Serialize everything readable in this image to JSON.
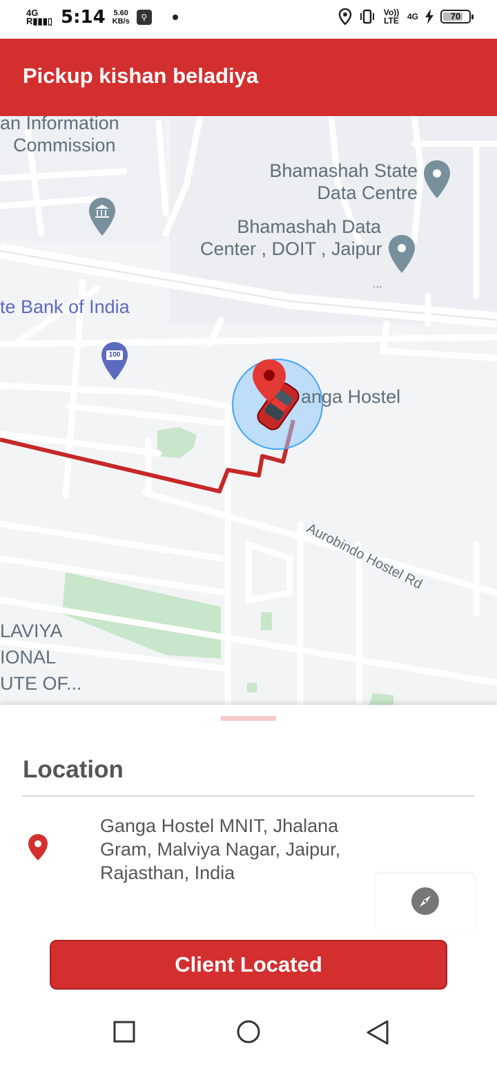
{
  "status_bar": {
    "network": "4G",
    "signal": "R",
    "time": "5:14",
    "speed_value": "5.60",
    "speed_unit": "KB/s",
    "volte": "Vo)) LTE",
    "network_right": "4G",
    "battery": "70"
  },
  "app_bar": {
    "title": "Pickup kishan beladiya"
  },
  "map": {
    "labels": {
      "commission_1": "an Information",
      "commission_2": "Commission",
      "bhamashah_state_1": "Bhamashah State",
      "bhamashah_state_2": "Data Centre",
      "bhamashah_data_1": "Bhamashah Data",
      "bhamashah_data_2": "Center , DOIT , Jaipur",
      "ellipsis": "...",
      "bank": "te Bank of India",
      "ganga": "anga Hostel",
      "road": "Aurobindo Hostel Rd",
      "malaviya_1": "LAVIYA",
      "malaviya_2": "IONAL",
      "malaviya_3": "UTE OF..."
    },
    "poi_badge": "100"
  },
  "sheet": {
    "title": "Location",
    "address": "Ganga Hostel MNIT, Jhalana Gram, Malviya Nagar, Jaipur, Rajasthan, India",
    "button": "Client Located"
  },
  "colors": {
    "brand": "#d32f2f",
    "route": "#c62828",
    "accuracy": "#90caf9"
  }
}
